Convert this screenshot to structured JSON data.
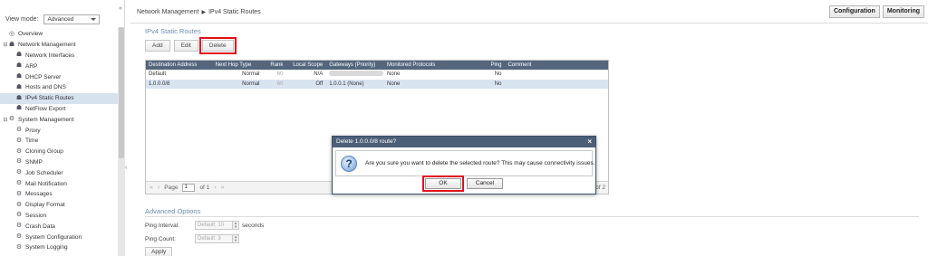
{
  "sidebar": {
    "view_mode_label": "View mode:",
    "view_mode_value": "Advanced",
    "collapse_glyph": "«",
    "expand_glyph": "‹",
    "items": [
      {
        "label": "Overview",
        "level": 0,
        "icon": "overview-icon",
        "glyph": "◎",
        "twisty": ""
      },
      {
        "label": "Network Management",
        "level": 0,
        "icon": "network-icon",
        "glyph": "☗",
        "twisty": "⊟"
      },
      {
        "label": "Network Interfaces",
        "level": 1,
        "icon": "network-icon",
        "glyph": "☗",
        "twisty": ""
      },
      {
        "label": "ARP",
        "level": 1,
        "icon": "network-icon",
        "glyph": "☗",
        "twisty": ""
      },
      {
        "label": "DHCP Server",
        "level": 1,
        "icon": "network-icon",
        "glyph": "☗",
        "twisty": ""
      },
      {
        "label": "Hosts and DNS",
        "level": 1,
        "icon": "network-icon",
        "glyph": "☗",
        "twisty": ""
      },
      {
        "label": "IPv4 Static Routes",
        "level": 1,
        "icon": "network-icon",
        "glyph": "☗",
        "twisty": "",
        "selected": true
      },
      {
        "label": "NetFlow Export",
        "level": 1,
        "icon": "network-icon",
        "glyph": "☗",
        "twisty": ""
      },
      {
        "label": "System Management",
        "level": 0,
        "icon": "gear-icon",
        "glyph": "⚙",
        "twisty": "⊟"
      },
      {
        "label": "Proxy",
        "level": 1,
        "icon": "gear-icon",
        "glyph": "⚙",
        "twisty": ""
      },
      {
        "label": "Time",
        "level": 1,
        "icon": "gear-icon",
        "glyph": "⚙",
        "twisty": ""
      },
      {
        "label": "Cloning Group",
        "level": 1,
        "icon": "gear-icon",
        "glyph": "⚙",
        "twisty": ""
      },
      {
        "label": "SNMP",
        "level": 1,
        "icon": "gear-icon",
        "glyph": "⚙",
        "twisty": ""
      },
      {
        "label": "Job Scheduler",
        "level": 1,
        "icon": "gear-icon",
        "glyph": "⚙",
        "twisty": ""
      },
      {
        "label": "Mail Notification",
        "level": 1,
        "icon": "gear-icon",
        "glyph": "⚙",
        "twisty": ""
      },
      {
        "label": "Messages",
        "level": 1,
        "icon": "gear-icon",
        "glyph": "⚙",
        "twisty": ""
      },
      {
        "label": "Display Format",
        "level": 1,
        "icon": "gear-icon",
        "glyph": "⚙",
        "twisty": ""
      },
      {
        "label": "Session",
        "level": 1,
        "icon": "gear-icon",
        "glyph": "⚙",
        "twisty": ""
      },
      {
        "label": "Crash Data",
        "level": 1,
        "icon": "gear-icon",
        "glyph": "⚙",
        "twisty": ""
      },
      {
        "label": "System Configuration",
        "level": 1,
        "icon": "gear-icon",
        "glyph": "⚙",
        "twisty": ""
      },
      {
        "label": "System Logging",
        "level": 1,
        "icon": "gear-icon",
        "glyph": "⚙",
        "twisty": ""
      }
    ]
  },
  "header": {
    "breadcrumb_parent": "Network Management",
    "breadcrumb_sep": "▶",
    "breadcrumb_current": "IPv4 Static Routes",
    "configuration_button": "Configuration",
    "monitoring_button": "Monitoring"
  },
  "routes": {
    "section_title": "IPv4 Static Routes",
    "add_button": "Add",
    "edit_button": "Edit",
    "delete_button": "Delete",
    "columns": [
      "Destination Address",
      "Next Hop Type",
      "Rank",
      "Local Scope",
      "Gateways (Priority)",
      "Monitored Protocols",
      "Ping",
      "Comment"
    ],
    "rows": [
      {
        "dest": "Default",
        "nexthop": "Normal",
        "rank": "60",
        "scope": "N/A",
        "gateway": "",
        "protocols": "None",
        "ping": "No",
        "comment": ""
      },
      {
        "dest": "1.0.0.0/8",
        "nexthop": "Normal",
        "rank": "60",
        "scope": "Off",
        "gateway": "1.0.0.1 (None)",
        "protocols": "None",
        "ping": "No",
        "comment": "",
        "selected": true
      }
    ],
    "pager": {
      "first": "«",
      "prev": "‹",
      "next": "›",
      "last": "»",
      "page_label": "Page",
      "page_value": "1",
      "of_label": "of 1",
      "count_text": "of 2"
    }
  },
  "advanced": {
    "title": "Advanced Options",
    "ping_interval_label": "Ping Interval:",
    "ping_interval_placeholder": "Default: 10",
    "ping_interval_unit": "seconds",
    "ping_count_label": "Ping Count:",
    "ping_count_placeholder": "Default: 3",
    "spin_up": "▲",
    "spin_down": "▼",
    "apply_button": "Apply"
  },
  "dialog": {
    "title": "Delete 1.0.0.0/8 route?",
    "close_glyph": "×",
    "icon_glyph": "?",
    "message": "Are you sure you want to delete the selected route? This may cause connectivity issues.",
    "ok_button": "OK",
    "cancel_button": "Cancel"
  }
}
